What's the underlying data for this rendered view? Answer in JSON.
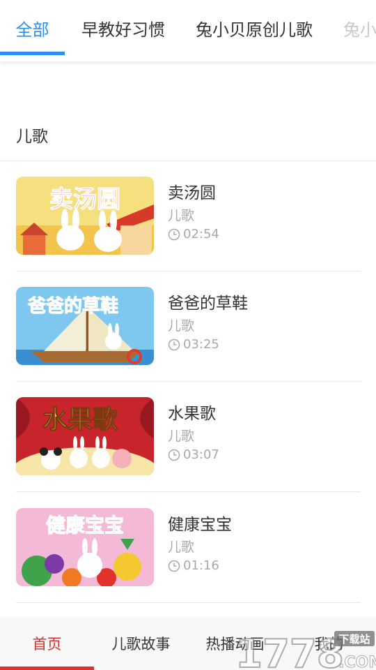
{
  "top_tabs": [
    {
      "label": "全部"
    },
    {
      "label": "早教好习惯"
    },
    {
      "label": "兔小贝原创儿歌"
    },
    {
      "label": "兔小"
    }
  ],
  "section": {
    "title": "儿歌"
  },
  "songs": [
    {
      "title": "卖汤圆",
      "thumb_text": "卖汤圆",
      "category": "儿歌",
      "duration": "02:54"
    },
    {
      "title": "爸爸的草鞋",
      "thumb_text": "爸爸的草鞋",
      "category": "儿歌",
      "duration": "03:25"
    },
    {
      "title": "水果歌",
      "thumb_text": "水果歌",
      "category": "儿歌",
      "duration": "03:07"
    },
    {
      "title": "健康宝宝",
      "thumb_text": "健康宝宝",
      "category": "儿歌",
      "duration": "01:16"
    }
  ],
  "bottom_nav": [
    {
      "label": "首页"
    },
    {
      "label": "儿歌故事"
    },
    {
      "label": "热播动画"
    },
    {
      "label": "我的"
    }
  ],
  "watermark": {
    "number": "1778",
    "badge": "下载站",
    "suffix": ".COM"
  },
  "colors": {
    "active_tab": "#2a8ff0",
    "active_bottom": "#d8332f",
    "meta_text": "#a9a9a9"
  }
}
